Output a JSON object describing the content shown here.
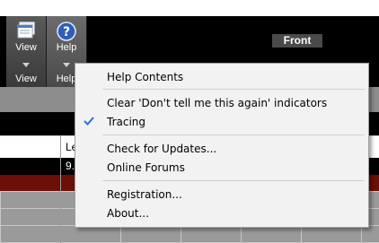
{
  "toolbar": {
    "buttons": [
      {
        "label_top": "View",
        "label_bottom": "View",
        "icon": "window-icon"
      },
      {
        "label_top": "Help",
        "label_bottom": "Help",
        "icon": "help-icon"
      }
    ],
    "front_tab": "Front"
  },
  "table": {
    "header_cell": "Le",
    "data_cell": "9."
  },
  "menu": {
    "items": [
      {
        "label": "Help Contents",
        "checked": false
      },
      {
        "label": "Clear 'Don't tell me this again' indicators",
        "checked": false
      },
      {
        "label": "Tracing",
        "checked": true
      },
      {
        "label": "Check for Updates...",
        "checked": false
      },
      {
        "label": "Online Forums",
        "checked": false
      },
      {
        "label": "Registration...",
        "checked": false
      },
      {
        "label": "About...",
        "checked": false
      }
    ]
  },
  "colors": {
    "menu_bg": "#f2f2f2",
    "check_blue": "#2a6fd6",
    "toolbar_bg": "#000000",
    "row_red": "#6b0f08"
  }
}
